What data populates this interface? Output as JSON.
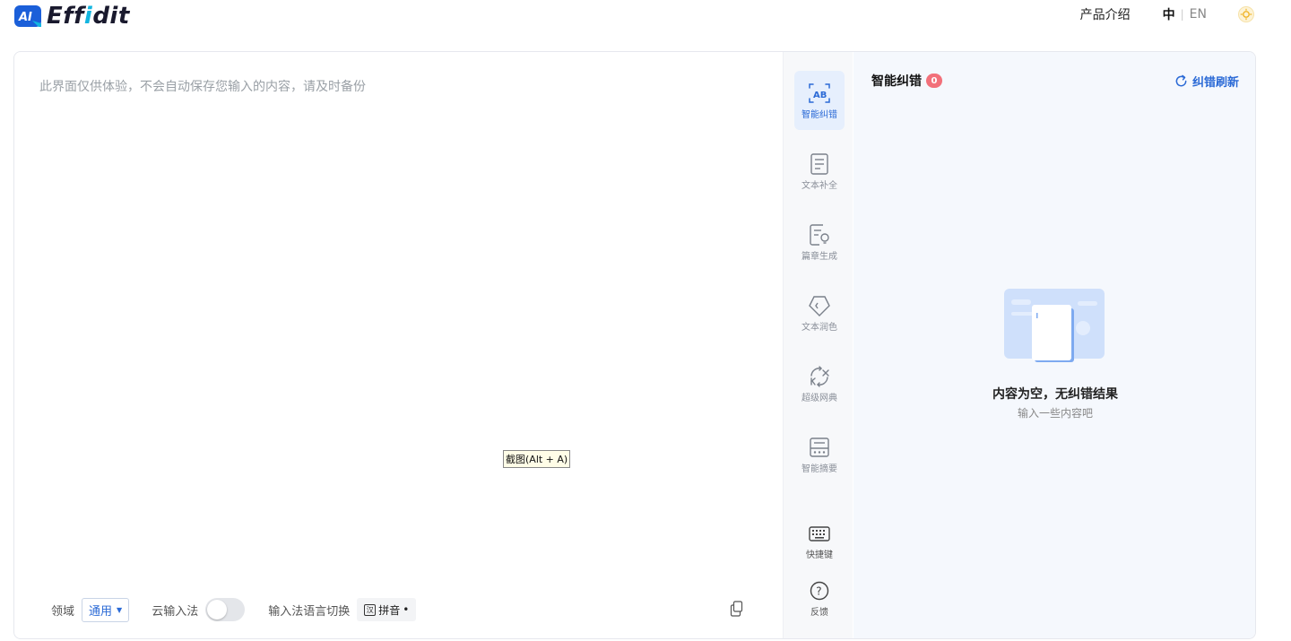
{
  "header": {
    "logo_badge": "AI",
    "logo_text_pre": "Eff",
    "logo_text_i": "i",
    "logo_text_post": "dit",
    "nav_product": "产品介绍",
    "lang_zh": "中",
    "lang_sep": "|",
    "lang_en": "EN"
  },
  "editor": {
    "placeholder": "此界面仅供体验，不会自动保存您输入的内容，请及时备份",
    "tooltip": "截图(Alt + A)"
  },
  "bottom_bar": {
    "domain_label": "领域",
    "domain_value": "通用",
    "cloud_ime_label": "云输入法",
    "cloud_ime_enabled": false,
    "ime_switch_label": "输入法语言切换",
    "ime_box_char": "汉",
    "ime_mode": "拼音",
    "ime_dot": "•"
  },
  "rail": {
    "tools": [
      {
        "label": "智能纠错",
        "icon": "ab-scan-icon",
        "active": true
      },
      {
        "label": "文本补全",
        "icon": "document-icon",
        "active": false
      },
      {
        "label": "篇章生成",
        "icon": "document-bulb-icon",
        "active": false
      },
      {
        "label": "文本润色",
        "icon": "diamond-tag-icon",
        "active": false
      },
      {
        "label": "超级网典",
        "icon": "translate-icon",
        "active": false
      },
      {
        "label": "智能摘要",
        "icon": "summary-icon",
        "active": false
      }
    ],
    "shortcuts_label": "快捷键",
    "feedback_label": "反馈",
    "feedback_glyph": "?"
  },
  "panel": {
    "title": "智能纠错",
    "count": "0",
    "refresh_label": "纠错刷新",
    "empty_title": "内容为空，无纠错结果",
    "empty_sub": "输入一些内容吧"
  },
  "colors": {
    "accent": "#2b6ad6",
    "badge": "#f2707a",
    "panel_bg": "#f5f8fd"
  }
}
